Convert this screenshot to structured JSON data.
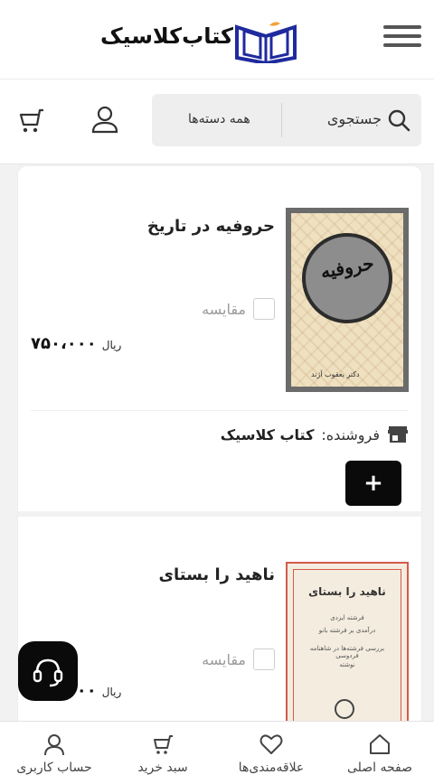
{
  "header": {
    "logo_text": "کتاب‌کلاسیک"
  },
  "search": {
    "label": "جستجوی",
    "category": "همه دسته‌ها"
  },
  "products": [
    {
      "title": "حروفیه در تاریخ",
      "compare_label": "مقایسه",
      "price": "۷۵۰،۰۰۰",
      "currency": "ریال",
      "seller_label": "فروشنده:",
      "seller_name": "کتاب کلاسیک",
      "add_label": "+"
    },
    {
      "title": "ناهید را بستای",
      "compare_label": "مقایسه",
      "price": "۶۰۰،۰۰۰",
      "currency": "ریال"
    }
  ],
  "covers": {
    "cover1_calligraphy": "حروفیه",
    "cover1_author": "دکتر یعقوب آژند",
    "cover2_title": "ناهید را بستای",
    "cover2_line1": "فرشته ایزدی",
    "cover2_line2": "درآمدی بر فرشته بانو",
    "cover2_line3": "بررسی فرشته‌ها در شاهنامه فردوسی",
    "cover2_line4": "نوشته"
  },
  "bottom_nav": {
    "home": "صفحه اصلی",
    "favorites": "علاقه‌مندی‌ها",
    "cart": "سبد خرید",
    "account": "حساب کاربری"
  },
  "colors": {
    "accent": "#0a0a0a",
    "logo_blue": "#1f2a9e",
    "logo_orange": "#f2a33a"
  },
  "icons": {
    "menu": "menu-icon",
    "search": "search-icon",
    "user": "user-icon",
    "cart": "cart-icon",
    "store": "store-icon",
    "support": "headset-icon",
    "home": "home-icon",
    "heart": "heart-icon"
  }
}
